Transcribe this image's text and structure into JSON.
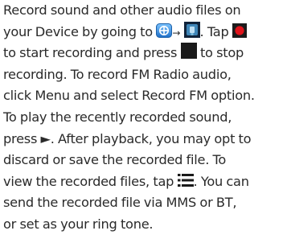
{
  "manual": {
    "p1": "Record sound and other audio files on",
    "p2": "your Device by going to",
    "arrow": "→",
    "p3": ". Tap",
    "p4": "to start recording and press",
    "p5": "to stop",
    "p6": "recording. To record FM Radio audio,",
    "p7": "click Menu and select Record FM option.",
    "p8": "To play the recently recorded sound,",
    "p9": "press ►. After playback, you may opt to",
    "p10": "discard or save the recorded file.  To",
    "p11": "view the recorded files, tap",
    "p12": ". You can",
    "p13": "send the recorded file via MMS or BT,",
    "p14": "or set as your ring tone."
  },
  "icons": {
    "apps": "apps-grid-icon",
    "recorder": "sound-recorder-app-icon",
    "record": "record-button-icon",
    "stop": "stop-button-icon",
    "list": "recordings-list-icon"
  },
  "colors": {
    "text": "#2a2a2a",
    "record_red": "#e0141b",
    "stop_black": "#1a1a1a",
    "apps_blue": "#2f86d6"
  }
}
